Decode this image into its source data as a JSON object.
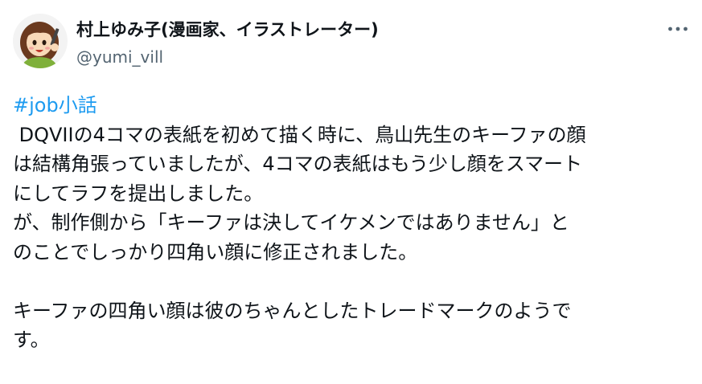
{
  "author": {
    "name": "村上ゆみ子(漫画家、イラストレーター)",
    "handle": "@yumi_vill",
    "avatar_icon": "avatar-illustration-icon"
  },
  "more_icon": "more-dots-icon",
  "colors": {
    "text": "#0f1419",
    "secondary": "#536471",
    "hashtag": "#1d9bf0"
  },
  "tweet": {
    "hashtag": "#job小話",
    "lines": [
      " DQVIIの4コマの表紙を初めて描く時に、鳥山先生のキーファの顔",
      "は結構角張っていましたが、4コマの表紙はもう少し顔をスマート",
      "にしてラフを提出しました。",
      "が、制作側から「キーファは決して​イケメンではありません」と",
      "のことでしっかり四角い顔に修正されました。",
      "",
      "キーファの四角い顔は彼のちゃんとしたトレードマークのようで",
      "す。"
    ]
  }
}
